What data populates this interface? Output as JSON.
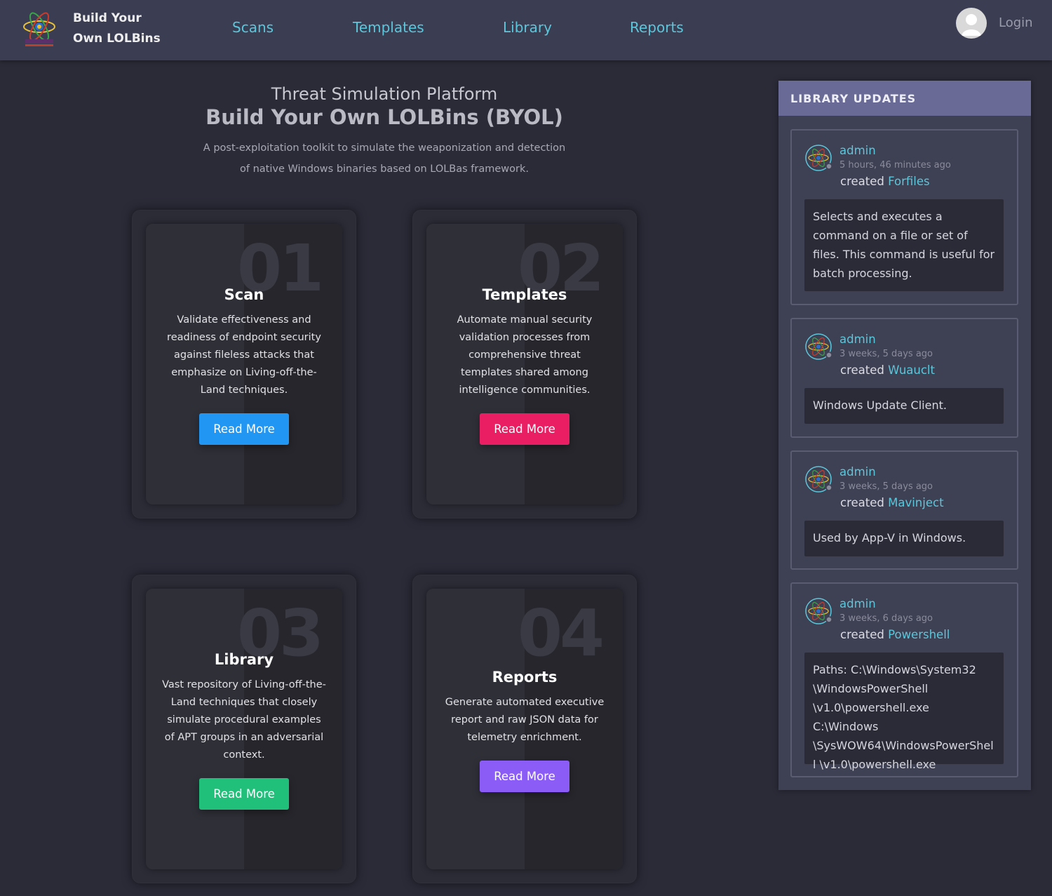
{
  "nav": {
    "brand_line1": "Build Your",
    "brand_line2": "Own LOLBins",
    "links": [
      "Scans",
      "Templates",
      "Library",
      "Reports"
    ],
    "login": "Login"
  },
  "hero": {
    "subtitle": "Threat Simulation Platform",
    "title": "Build Your Own LOLBins (BYOL)",
    "desc_line1": "A post-exploitation toolkit to simulate the weaponization and detection",
    "desc_line2": "of native Windows binaries based on LOLBas framework."
  },
  "cards": [
    {
      "num": "01",
      "title": "Scan",
      "desc": "Validate effectiveness and readiness of endpoint security against fileless attacks that emphasize on Living-off-the-Land techniques.",
      "button": "Read More",
      "color": "#2196f3"
    },
    {
      "num": "02",
      "title": "Templates",
      "desc": "Automate manual security validation processes from comprehensive threat templates shared among intelligence communities.",
      "button": "Read More",
      "color": "#e91e63"
    },
    {
      "num": "03",
      "title": "Library",
      "desc": "Vast repository of Living-off-the-Land techniques that closely simulate procedural examples of APT groups in an adversarial context.",
      "button": "Read More",
      "color": "#21c07a"
    },
    {
      "num": "04",
      "title": "Reports",
      "desc": "Generate automated executive report and raw JSON data for telemetry enrichment.",
      "button": "Read More",
      "color": "#8b5cf6"
    }
  ],
  "sidebar": {
    "header": "LIBRARY UPDATES",
    "updates": [
      {
        "user": "admin",
        "time": "5 hours, 46 minutes ago",
        "action": "created",
        "item": "Forfiles",
        "desc": "Selects and executes a command on a file or set of files. This command is useful for batch processing."
      },
      {
        "user": "admin",
        "time": "3 weeks, 5 days ago",
        "action": "created",
        "item": "Wuauclt",
        "desc": "Windows Update Client."
      },
      {
        "user": "admin",
        "time": "3 weeks, 5 days ago",
        "action": "created",
        "item": "Mavinject",
        "desc": "Used by App-V in Windows."
      },
      {
        "user": "admin",
        "time": "3 weeks, 6 days ago",
        "action": "created",
        "item": "Powershell",
        "desc": "Paths: C:\\Windows\\System32 \\WindowsPowerShell \\v1.0\\powershell.exe C:\\Windows \\SysWOW64\\WindowsPowerShell \\v1.0\\powershell.exe"
      }
    ]
  }
}
